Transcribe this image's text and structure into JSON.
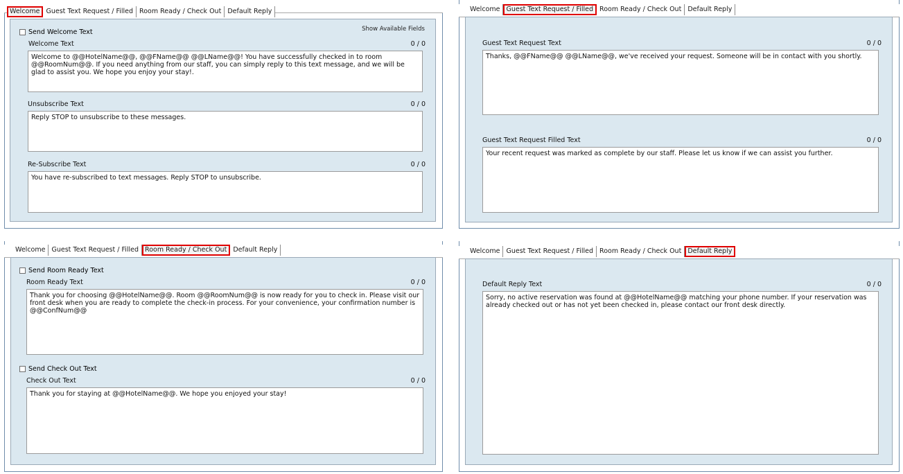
{
  "tabs": [
    "Welcome",
    "Guest Text Request / Filled",
    "Room Ready / Check Out",
    "Default Reply"
  ],
  "panel1": {
    "selected_tab": "Welcome",
    "send_label": "Send Welcome Text",
    "show_fields": "Show Available Fields",
    "welcome_label": "Welcome Text",
    "welcome_count": "0 / 0",
    "welcome_text": "Welcome to @@HotelName@@, @@FName@@ @@LName@@! You have successfully checked in to room @@RoomNum@@. If you need anything from our staff, you can simply reply to this text message, and we will be glad to assist you. We hope you enjoy your stay!.",
    "unsub_label": "Unsubscribe Text",
    "unsub_count": "0 / 0",
    "unsub_text": "Reply STOP to unsubscribe to these messages.",
    "resub_label": "Re-Subscribe Text",
    "resub_count": "0 / 0",
    "resub_text": "You have re-subscribed to text messages. Reply STOP to unsubscribe."
  },
  "panel2": {
    "selected_tab": "Guest Text Request / Filled",
    "request_label": "Guest Text Request Text",
    "request_count": "0 / 0",
    "request_text": "Thanks, @@FName@@ @@LName@@, we've received your request. Someone will be in contact with you shortly.",
    "filled_label": "Guest Text Request Filled Text",
    "filled_count": "0 / 0",
    "filled_text": "Your recent request was marked as complete by our staff. Please let us know if we can assist you further."
  },
  "panel3": {
    "selected_tab": "Room Ready / Check Out",
    "send_ready_label": "Send Room Ready Text",
    "ready_label": "Room Ready Text",
    "ready_count": "0 / 0",
    "ready_text": "Thank you for choosing @@HotelName@@. Room @@RoomNum@@ is now ready for you to check in. Please visit our front desk when you are ready to complete the check-in process. For your convenience, your confirmation number is @@ConfNum@@",
    "send_checkout_label": "Send Check Out Text",
    "checkout_label": "Check Out Text",
    "checkout_count": "0 / 0",
    "checkout_text": "Thank you for staying at @@HotelName@@. We hope you enjoyed your stay!"
  },
  "panel4": {
    "selected_tab": "Default Reply",
    "default_label": "Default Reply Text",
    "default_count": "0 / 0",
    "default_text": "Sorry, no active reservation was found at @@HotelName@@ matching your phone number. If your reservation was already checked out or has not yet been checked in, please contact our front desk directly."
  }
}
